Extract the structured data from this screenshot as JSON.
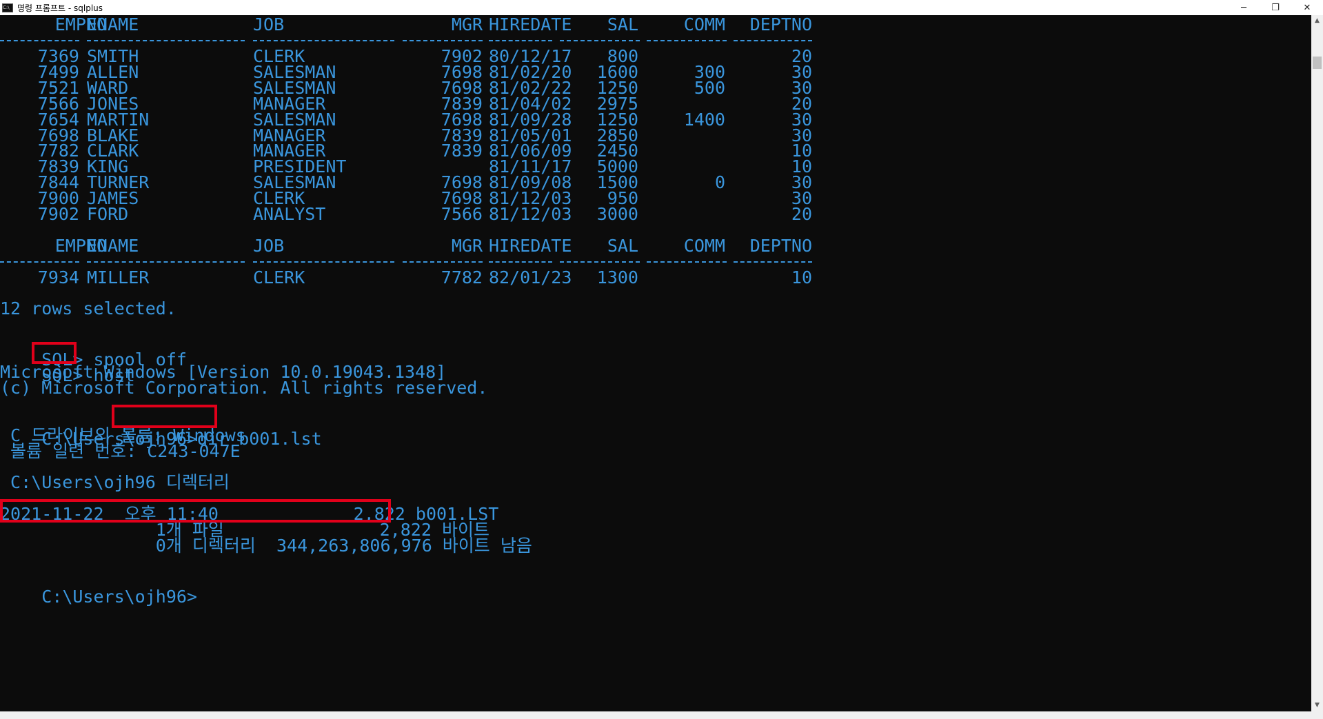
{
  "window": {
    "title": "명령 프롬프트 - sqlplus",
    "icon_text": "C:\\",
    "minimize": "─",
    "maximize": "❐",
    "close": "✕"
  },
  "table": {
    "headers": [
      "EMPNO",
      "ENAME",
      "JOB",
      "MGR",
      "HIREDATE",
      "SAL",
      "COMM",
      "DEPTNO"
    ],
    "rows": [
      [
        "7369",
        "SMITH",
        "CLERK",
        "7902",
        "80/12/17",
        "800",
        "",
        "20"
      ],
      [
        "7499",
        "ALLEN",
        "SALESMAN",
        "7698",
        "81/02/20",
        "1600",
        "300",
        "30"
      ],
      [
        "7521",
        "WARD",
        "SALESMAN",
        "7698",
        "81/02/22",
        "1250",
        "500",
        "30"
      ],
      [
        "7566",
        "JONES",
        "MANAGER",
        "7839",
        "81/04/02",
        "2975",
        "",
        "20"
      ],
      [
        "7654",
        "MARTIN",
        "SALESMAN",
        "7698",
        "81/09/28",
        "1250",
        "1400",
        "30"
      ],
      [
        "7698",
        "BLAKE",
        "MANAGER",
        "7839",
        "81/05/01",
        "2850",
        "",
        "30"
      ],
      [
        "7782",
        "CLARK",
        "MANAGER",
        "7839",
        "81/06/09",
        "2450",
        "",
        "10"
      ],
      [
        "7839",
        "KING",
        "PRESIDENT",
        "",
        "81/11/17",
        "5000",
        "",
        "10"
      ],
      [
        "7844",
        "TURNER",
        "SALESMAN",
        "7698",
        "81/09/08",
        "1500",
        "0",
        "30"
      ],
      [
        "7900",
        "JAMES",
        "CLERK",
        "7698",
        "81/12/03",
        "950",
        "",
        "30"
      ],
      [
        "7902",
        "FORD",
        "ANALYST",
        "7566",
        "81/12/03",
        "3000",
        "",
        "20"
      ]
    ],
    "rows_page2": [
      [
        "7934",
        "MILLER",
        "CLERK",
        "7782",
        "82/01/23",
        "1300",
        "",
        "10"
      ]
    ]
  },
  "console": {
    "rows_selected": "12 rows selected.",
    "spool_prompt": "SQL>",
    "spool_cmd": "spool off",
    "host_prompt": "SQL>",
    "host_cmd": "host",
    "win_version": "Microsoft Windows [Version 10.0.19043.1348]",
    "copyright": "(c) Microsoft Corporation. All rights reserved.",
    "cwd_prompt": "C:\\Users\\ojh96>",
    "dir_cmd": "dir b001.lst",
    "volume_line": " C 드라이브의 볼륨: Windows",
    "serial_line": " 볼륨 일련 번호: C243-047E",
    "directory_line": " C:\\Users\\ojh96 디렉터리",
    "file_line": "2021-11-22  오후 11:40             2,822 b001.LST",
    "files_summary": "               1개 파일               2,822 바이트",
    "dirs_summary": "               0개 디렉터리  344,263,806,976 바이트 남음",
    "final_prompt": "C:\\Users\\ojh96>"
  },
  "colors": {
    "background": "#0c0c0c",
    "text": "#3a96dd",
    "highlight": "#e1001a"
  }
}
